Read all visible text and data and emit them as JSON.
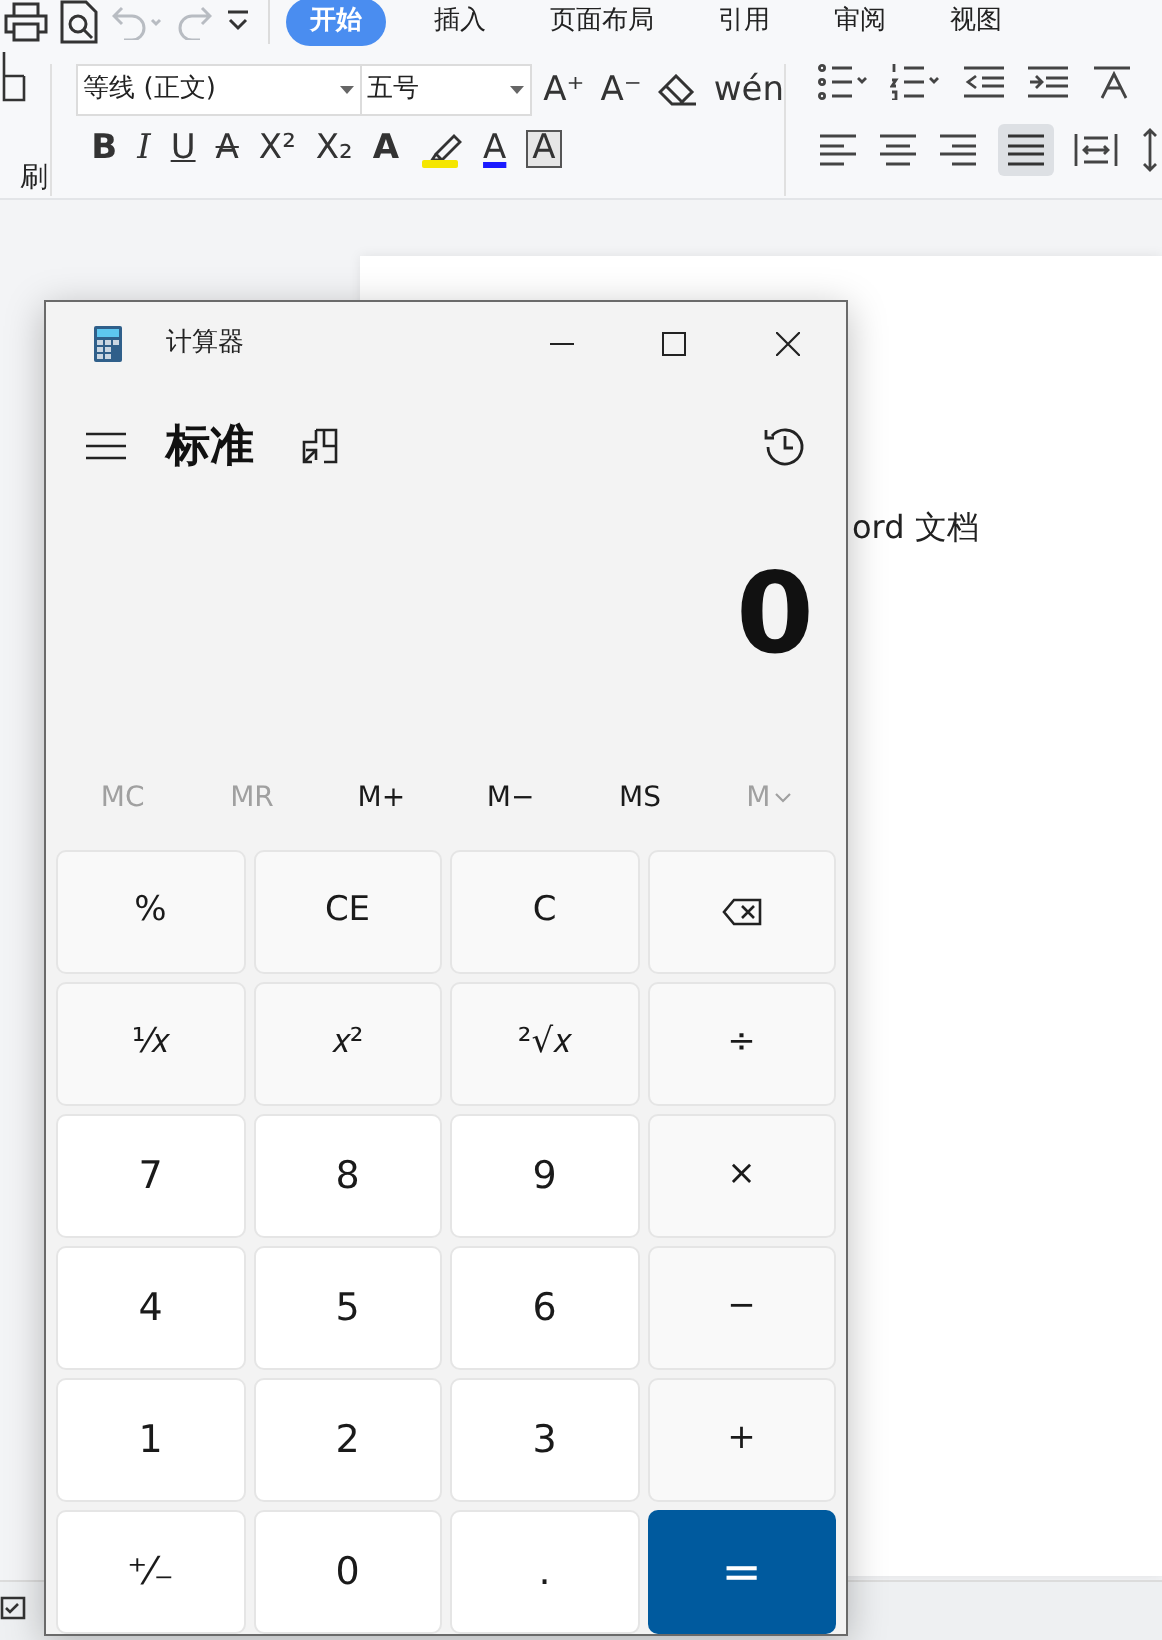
{
  "quick_access": [
    {
      "kind": "print",
      "disabled": false
    },
    {
      "kind": "preview",
      "disabled": false
    },
    {
      "kind": "undo",
      "disabled": true
    },
    {
      "kind": "redo",
      "disabled": true
    },
    {
      "kind": "more",
      "disabled": false
    }
  ],
  "ribbon_tabs": [
    {
      "label": "开始",
      "selected": true
    },
    {
      "label": "插入",
      "selected": false
    },
    {
      "label": "页面布局",
      "selected": false
    },
    {
      "label": "引用",
      "selected": false
    },
    {
      "label": "审阅",
      "selected": false
    },
    {
      "label": "视图",
      "selected": false
    }
  ],
  "format_painter": {
    "label": "刷"
  },
  "font": {
    "value": "等线 (正文)"
  },
  "font_size": {
    "value": "五号"
  },
  "format_buttons_row1": [
    {
      "kind": "text",
      "label": "A⁺"
    },
    {
      "kind": "text",
      "label": "A⁻"
    },
    {
      "kind": "eraser"
    },
    {
      "kind": "text",
      "label": "wén"
    }
  ],
  "format_buttons_row2": [
    {
      "kind": "bold",
      "label": "B"
    },
    {
      "kind": "italic",
      "label": "I"
    },
    {
      "kind": "underline",
      "label": "U"
    },
    {
      "kind": "strike",
      "label": "A"
    },
    {
      "kind": "plain",
      "label": "X²"
    },
    {
      "kind": "plain",
      "label": "X₂"
    },
    {
      "kind": "effect",
      "label": "A"
    },
    {
      "kind": "highlight",
      "color": "#f5e600"
    },
    {
      "kind": "color",
      "label": "A",
      "color": "#1a1aff"
    },
    {
      "kind": "boxed",
      "label": "A"
    }
  ],
  "document": {
    "text": "ord 文档"
  },
  "calculator": {
    "title": "计算器",
    "mode": "标准",
    "display": "0",
    "memory": [
      {
        "label": "MC",
        "disabled": true
      },
      {
        "label": "MR",
        "disabled": true
      },
      {
        "label": "M+",
        "disabled": false
      },
      {
        "label": "M−",
        "disabled": false
      },
      {
        "label": "MS",
        "disabled": false
      },
      {
        "label": "M",
        "disabled": true,
        "kind": "dropdown"
      }
    ],
    "keys": [
      {
        "label": "%",
        "kind": "op"
      },
      {
        "label": "CE",
        "kind": "op"
      },
      {
        "label": "C",
        "kind": "op"
      },
      {
        "kind": "backspace"
      },
      {
        "label": "¹⁄𝑥",
        "kind": "op"
      },
      {
        "label": "𝑥²",
        "kind": "op"
      },
      {
        "label": "²√𝑥",
        "kind": "op"
      },
      {
        "label": "÷",
        "kind": "op"
      },
      {
        "label": "7",
        "kind": "num"
      },
      {
        "label": "8",
        "kind": "num"
      },
      {
        "label": "9",
        "kind": "num"
      },
      {
        "label": "×",
        "kind": "op"
      },
      {
        "label": "4",
        "kind": "num"
      },
      {
        "label": "5",
        "kind": "num"
      },
      {
        "label": "6",
        "kind": "num"
      },
      {
        "label": "−",
        "kind": "op"
      },
      {
        "label": "1",
        "kind": "num"
      },
      {
        "label": "2",
        "kind": "num"
      },
      {
        "label": "3",
        "kind": "num"
      },
      {
        "label": "+",
        "kind": "op"
      },
      {
        "label": "⁺⁄₋",
        "kind": "num"
      },
      {
        "label": "0",
        "kind": "num"
      },
      {
        "label": ".",
        "kind": "num"
      },
      {
        "label": "=",
        "kind": "equals"
      }
    ]
  }
}
